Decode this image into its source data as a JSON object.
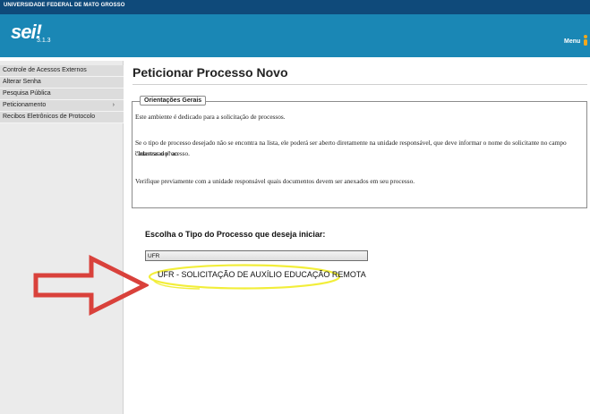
{
  "topbar": {
    "institution": "UNIVERSIDADE FEDERAL DE MATO GROSSO"
  },
  "header": {
    "logo": "sei!",
    "version": "3.1.3",
    "menu_label": "Menu"
  },
  "sidebar": {
    "items": [
      {
        "label": "Controle de Acessos Externos"
      },
      {
        "label": "Alterar Senha"
      },
      {
        "label": "Pesquisa Pública"
      },
      {
        "label": "Peticionamento",
        "arrow": "›"
      },
      {
        "label": "Recibos Eletrônicos de Protocolo"
      }
    ]
  },
  "main": {
    "title": "Peticionar Processo Novo",
    "orientation": {
      "legend": "Orientações Gerais",
      "paragraphs": [
        "Este ambiente é dedicado para a solicitação de processos.",
        "Se o tipo de processo desejado não se encontra na lista, ele poderá ser aberto diretamente na unidade responsável, que deve informar o nome do solicitante no campo \"Interessado\" ao",
        "cadastrar o processo.",
        "Verifique previamente com a unidade responsável quais documentos devem ser anexados em seu processo."
      ]
    },
    "choose_label": "Escolha o Tipo do Processo que deseja iniciar:",
    "filter_value": "UFR",
    "options": [
      {
        "label": "UFR - SOLICITAÇÃO DE AUXÍLIO EDUCAÇÃO REMOTA"
      }
    ]
  },
  "annotations": {
    "arrow_color": "#d9413b",
    "highlight_color": "#f2ee3a"
  }
}
